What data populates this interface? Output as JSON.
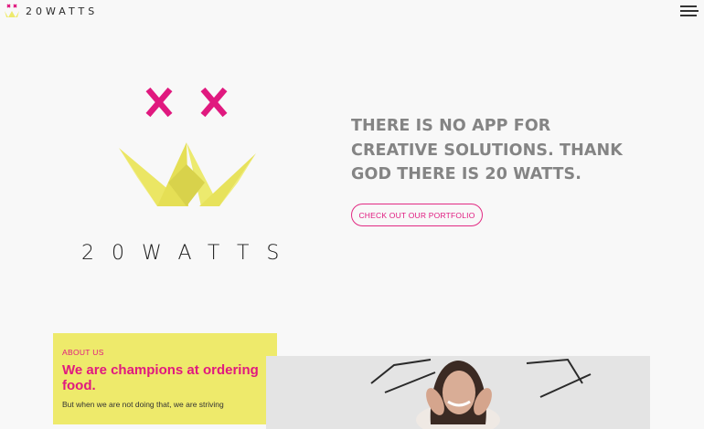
{
  "header": {
    "brand": "20WATTS",
    "menu_icon": "hamburger-menu-icon"
  },
  "hero": {
    "logo_wordmark": "20WATTS",
    "headline": "THERE IS NO APP FOR CREATIVE SOLUTIONS. THANK GOD THERE IS 20 WATTS.",
    "cta_label": "CHECK OUT OUR PORTFOLIO"
  },
  "about": {
    "label": "ABOUT US",
    "title": "We are champions at ordering food.",
    "body": "But when we are not doing that, we are striving"
  },
  "colors": {
    "accent_pink": "#e0197f",
    "crown_yellow": "#eeea6b",
    "headline_gray": "#848484",
    "background": "#f8f8f8"
  }
}
